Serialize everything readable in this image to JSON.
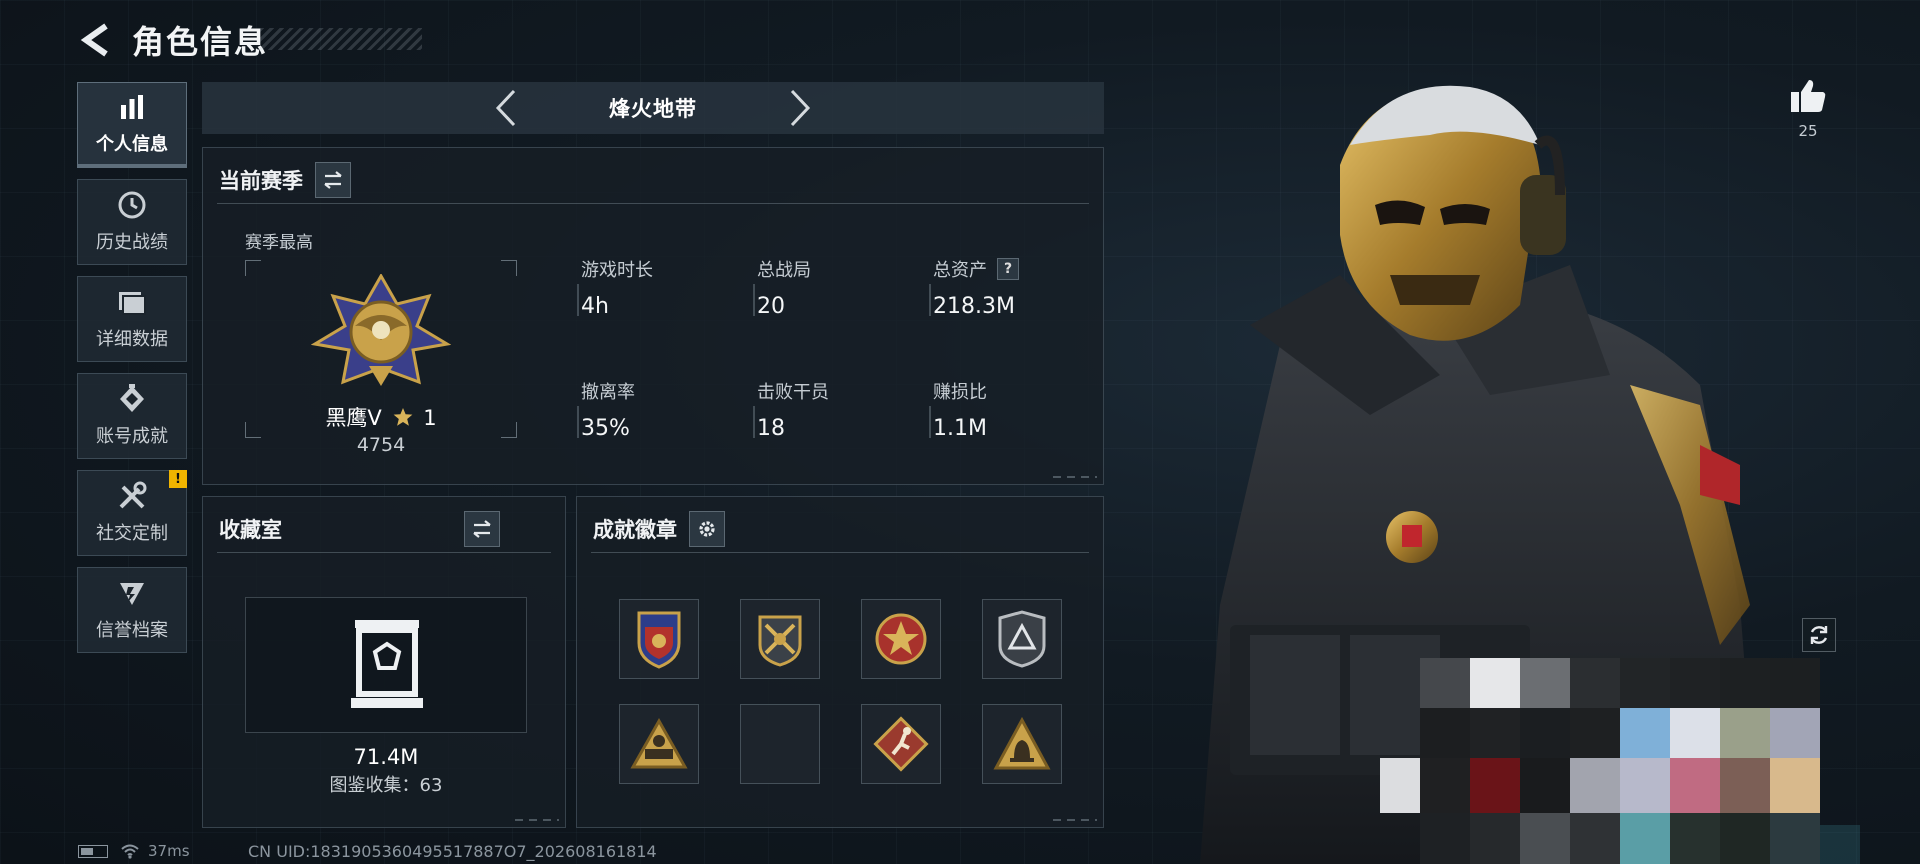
{
  "header": {
    "title": "角色信息"
  },
  "sidebar": {
    "items": [
      {
        "label": "个人信息",
        "icon": "bar-chart-icon",
        "active": true
      },
      {
        "label": "历史战绩",
        "icon": "clock-icon"
      },
      {
        "label": "详细数据",
        "icon": "folder-icon"
      },
      {
        "label": "账号成就",
        "icon": "achievement-icon"
      },
      {
        "label": "社交定制",
        "icon": "tools-icon",
        "badge": "!"
      },
      {
        "label": "信誉档案",
        "icon": "credit-icon"
      }
    ]
  },
  "mode": {
    "title": "烽火地带"
  },
  "season": {
    "title": "当前赛季",
    "best_label": "赛季最高",
    "rank_name": "黑鹰V",
    "rank_star": "1",
    "rank_score": "4754",
    "stats": [
      {
        "label": "游戏时长",
        "value": "4h"
      },
      {
        "label": "总战局",
        "value": "20"
      },
      {
        "label": "总资产",
        "value": "218.3M",
        "help": "?"
      },
      {
        "label": "撤离率",
        "value": "35%"
      },
      {
        "label": "击败干员",
        "value": "18"
      },
      {
        "label": "赚损比",
        "value": "1.1M"
      }
    ]
  },
  "collection": {
    "title": "收藏室",
    "value": "71.4M",
    "count_label": "图鉴收集：63"
  },
  "achievements": {
    "title": "成就徽章",
    "badge_count": 8
  },
  "likes": {
    "count": "25"
  },
  "footer": {
    "ping": "37ms",
    "uid": "CN UID:1831905360495517887O7_202608161814"
  },
  "colors": {
    "accent": "#3ee08f",
    "alert": "#f0b400",
    "gold": "#c9a24a"
  }
}
